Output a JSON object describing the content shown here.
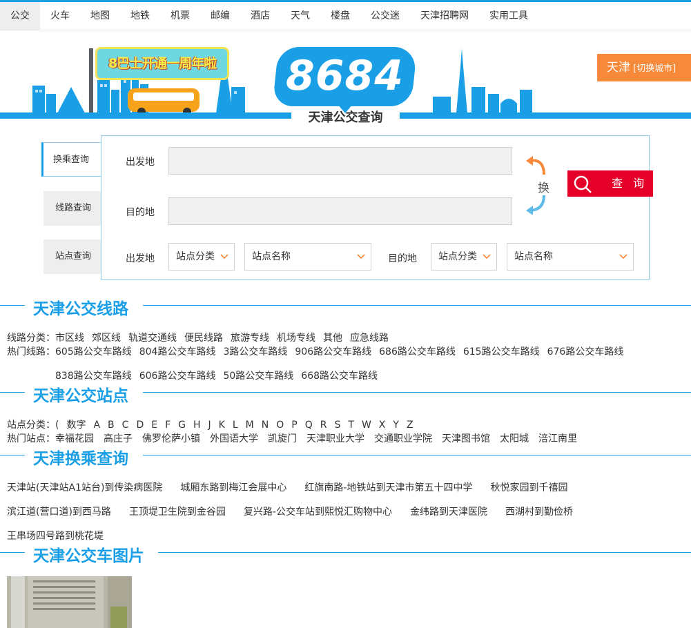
{
  "nav": {
    "items": [
      "公交",
      "火车",
      "地图",
      "地铁",
      "机票",
      "邮编",
      "酒店",
      "天气",
      "楼盘",
      "公交迷",
      "天津招聘网",
      "实用工具"
    ]
  },
  "header": {
    "banner_text": "8巴士开通一周年啦",
    "logo_number": "8684",
    "logo_subtitle": "天津公交查询",
    "city": "天津",
    "switch_city": "[切换城市]"
  },
  "search": {
    "tabs": [
      "换乘查询",
      "线路查询",
      "站点查询"
    ],
    "from_label": "出发地",
    "to_label": "目的地",
    "swap_label": "换",
    "query_button": "查 询",
    "station_from_label": "出发地",
    "station_to_label": "目的地",
    "station_category": "站点分类",
    "station_name": "站点名称"
  },
  "sections": {
    "lines": {
      "title": "天津公交线路",
      "category_label": "线路分类：",
      "categories": [
        "市区线",
        "郊区线",
        "轨道交通线",
        "便民线路",
        "旅游专线",
        "机场专线",
        "其他",
        "应急线路"
      ],
      "hot_label": "热门线路：",
      "hot_row1": [
        "605路公交车路线",
        "804路公交车路线",
        "3路公交车路线",
        "906路公交车路线",
        "686路公交车路线",
        "615路公交车路线",
        "676路公交车路线"
      ],
      "hot_row2": [
        "838路公交车路线",
        "606路公交车路线",
        "50路公交车路线",
        "668路公交车路线"
      ]
    },
    "stations": {
      "title": "天津公交站点",
      "category_label": "站点分类：",
      "letters": [
        "(",
        "数字",
        "A",
        "B",
        "C",
        "D",
        "E",
        "F",
        "G",
        "H",
        "J",
        "K",
        "L",
        "M",
        "N",
        "O",
        "P",
        "Q",
        "R",
        "S",
        "T",
        "W",
        "X",
        "Y",
        "Z"
      ],
      "hot_label": "热门站点：",
      "hot": [
        "幸福花园",
        "高庄子",
        "佛罗伦萨小镇",
        "外国语大学",
        "凯旋门",
        "天津职业大学",
        "交通职业学院",
        "天津图书馆",
        "太阳城",
        "涪江南里"
      ]
    },
    "transfer": {
      "title": "天津换乘查询",
      "row1": [
        "天津站(天津站A1站台)到传染病医院",
        "城厢东路到梅江会展中心",
        "红旗南路-地铁站到天津市第五十四中学",
        "秋悦家园到千禧园"
      ],
      "row2": [
        "滨江道(营口道)到西马路",
        "王顶堤卫生院到金谷园",
        "复兴路-公交车站到熙悦汇购物中心",
        "金纬路到天津医院",
        "西湖村到勤俭桥"
      ],
      "row3": [
        "王串场四号路到桃花堤"
      ]
    },
    "photos": {
      "title": "天津公交车图片"
    }
  },
  "colors": {
    "brand_blue": "#1a9fe6",
    "city_orange": "#f7893a",
    "query_red": "#e5002a",
    "swap_orange": "#f7893a",
    "swap_blue": "#5fbbe8"
  }
}
